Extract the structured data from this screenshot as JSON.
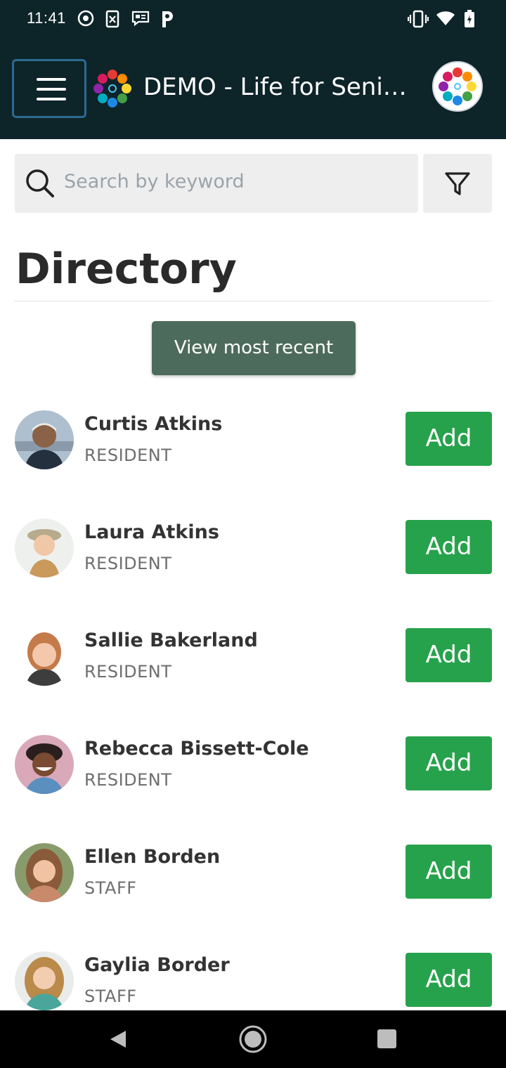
{
  "status_bar": {
    "time": "11:41"
  },
  "app_bar": {
    "title": "DEMO - Life for Senio…"
  },
  "search": {
    "placeholder": "Search by keyword"
  },
  "page": {
    "title": "Directory",
    "view_recent_label": "View most recent"
  },
  "people": [
    {
      "name": "Curtis Atkins",
      "role": "RESIDENT",
      "action": "Add"
    },
    {
      "name": "Laura Atkins",
      "role": "RESIDENT",
      "action": "Add"
    },
    {
      "name": "Sallie Bakerland",
      "role": "RESIDENT",
      "action": "Add"
    },
    {
      "name": "Rebecca Bissett-Cole",
      "role": "RESIDENT",
      "action": "Add"
    },
    {
      "name": "Ellen Borden",
      "role": "STAFF",
      "action": "Add"
    },
    {
      "name": "Gaylia Border",
      "role": "STAFF",
      "action": "Add"
    }
  ],
  "colors": {
    "header_bg": "#0d2429",
    "add_button": "#27a24c",
    "recent_button": "#4d6b5c"
  },
  "icons": [
    "menu-icon",
    "search-icon",
    "filter-icon",
    "back-icon",
    "home-icon",
    "recents-icon"
  ]
}
